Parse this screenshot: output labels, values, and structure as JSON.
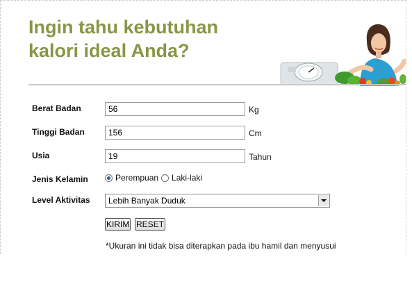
{
  "header": {
    "title_line1": "Ingin tahu kebutuhan",
    "title_line2": "kalori ideal Anda?"
  },
  "form": {
    "weight": {
      "label": "Berat Badan",
      "value": "56",
      "unit": "Kg"
    },
    "height": {
      "label": "Tinggi Badan",
      "value": "156",
      "unit": "Cm"
    },
    "age": {
      "label": "Usia",
      "value": "19",
      "unit": "Tahun"
    },
    "gender": {
      "label": "Jenis Kelamin",
      "options": [
        {
          "label": "Perempuan",
          "checked": true
        },
        {
          "label": "Laki-laki",
          "checked": false
        }
      ]
    },
    "activity": {
      "label": "Level Aktivitas",
      "selected": "Lebih Banyak Duduk"
    },
    "submit_label": "KIRIM",
    "reset_label": "RESET",
    "note": "*Ukuran ini tidak bisa diterapkan pada ibu hamil dan menyusui"
  },
  "colors": {
    "title": "#8a9545",
    "divider": "#c9c9c9",
    "radio_dot": "#2c5a9a"
  }
}
